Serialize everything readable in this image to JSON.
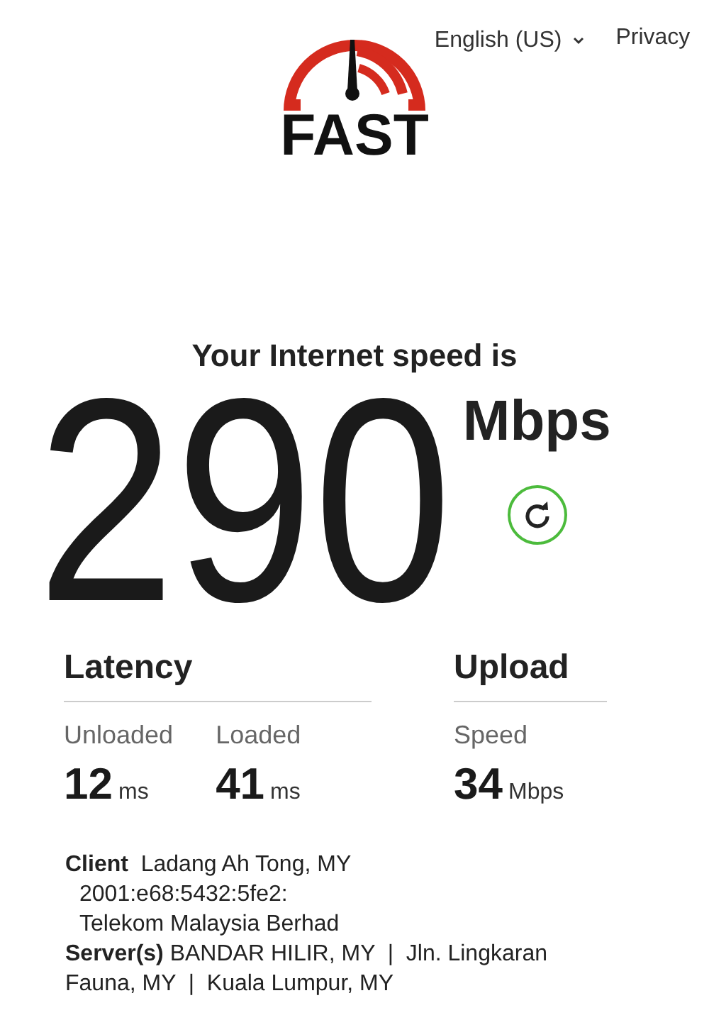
{
  "header": {
    "logo_text": "FAST",
    "language": "English (US)",
    "privacy_link": "Privacy"
  },
  "result": {
    "headline": "Your Internet speed is",
    "speed": "290",
    "unit": "Mbps"
  },
  "latency": {
    "title": "Latency",
    "items": [
      {
        "label": "Unloaded",
        "value": "12",
        "unit": "ms"
      },
      {
        "label": "Loaded",
        "value": "41",
        "unit": "ms"
      }
    ]
  },
  "upload": {
    "title": "Upload",
    "items": [
      {
        "label": "Speed",
        "value": "34",
        "unit": "Mbps"
      }
    ]
  },
  "client": {
    "line": "**Client**  Ladang Ah Tong, MY",
    "ip": "2001:e68:5432:5fe2:",
    "isp": "Telekom Malaysia Berhad"
  },
  "servers": {
    "line": "**Server(s)** BANDAR HILIR, MY  |  Jln. Lingkaran Fauna, MY  |  Kuala Lumpur, MY"
  }
}
